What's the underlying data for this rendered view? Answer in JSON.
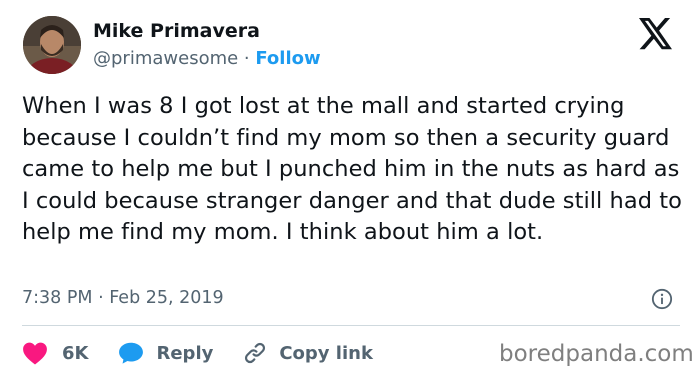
{
  "author": {
    "name": "Mike Primavera",
    "handle": "@primawesome",
    "separator": " · ",
    "follow_label": "Follow"
  },
  "tweet": {
    "text": "When I was 8 I got lost at the mall and started crying because I couldn’t find my mom so then a security guard came to help me but I punched him in the nuts as hard as I could because stranger danger and that dude still had to help me find my mom. I think about him a lot.",
    "timestamp": "7:38 PM · Feb 25, 2019"
  },
  "actions": {
    "like_count": "6K",
    "reply_label": "Reply",
    "copy_link_label": "Copy link"
  },
  "watermark": "boredpanda.com",
  "icons": {
    "platform_logo": "x-logo-icon",
    "info": "info-icon",
    "like": "heart-icon",
    "reply": "speech-bubble-icon",
    "copy_link": "link-icon"
  },
  "colors": {
    "follow": "#1d9bf0",
    "like": "#f91880",
    "reply": "#1d9bf0",
    "secondary_text": "#536471",
    "primary_text": "#0f1419"
  }
}
